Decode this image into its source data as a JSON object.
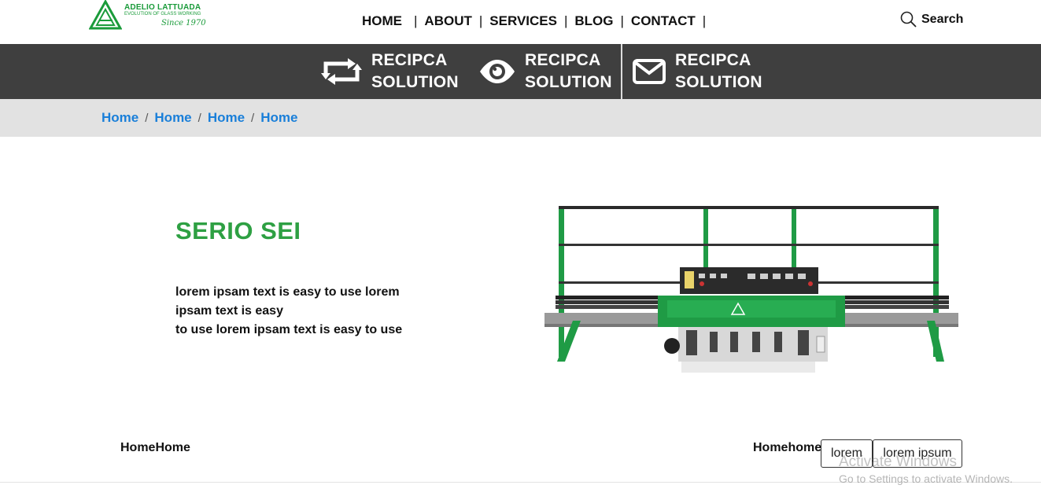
{
  "logo": {
    "brand": "ADELIO LATTUADA",
    "tagline": "EVOLUTION OF GLASS WORKING",
    "since": "Since 1970"
  },
  "nav": {
    "items": [
      "HOME",
      "ABOUT",
      "SERVICES",
      "BLOG",
      "CONTACT"
    ]
  },
  "search": {
    "label": "Search"
  },
  "features": [
    {
      "line1": "RECIPCA",
      "line2": "SOLUTION",
      "icon": "repeat-icon"
    },
    {
      "line1": "RECIPCA",
      "line2": "SOLUTION",
      "icon": "eye-icon"
    },
    {
      "line1": "RECIPCA",
      "line2": "SOLUTION",
      "icon": "envelope-icon"
    }
  ],
  "breadcrumb": [
    "Home",
    "Home",
    "Home",
    "Home"
  ],
  "hero": {
    "title": "SERIO SEI",
    "desc_line1": "lorem ipsam text is easy to use lorem ipsam text is easy",
    "desc_line2": "to use lorem ipsam text is easy to use"
  },
  "bottom": {
    "left_text": "HomeHome",
    "right_text": "Homehome",
    "button1": "lorem",
    "button2": "lorem ipsum"
  },
  "watermark": {
    "title": "Activate Windows",
    "subtitle": "Go to Settings to activate Windows."
  },
  "colors": {
    "brand_green": "#2ea043",
    "strip_bg": "#3f3f3f",
    "crumb_bg": "#e2e2e2",
    "link_blue": "#1a7fd9"
  }
}
